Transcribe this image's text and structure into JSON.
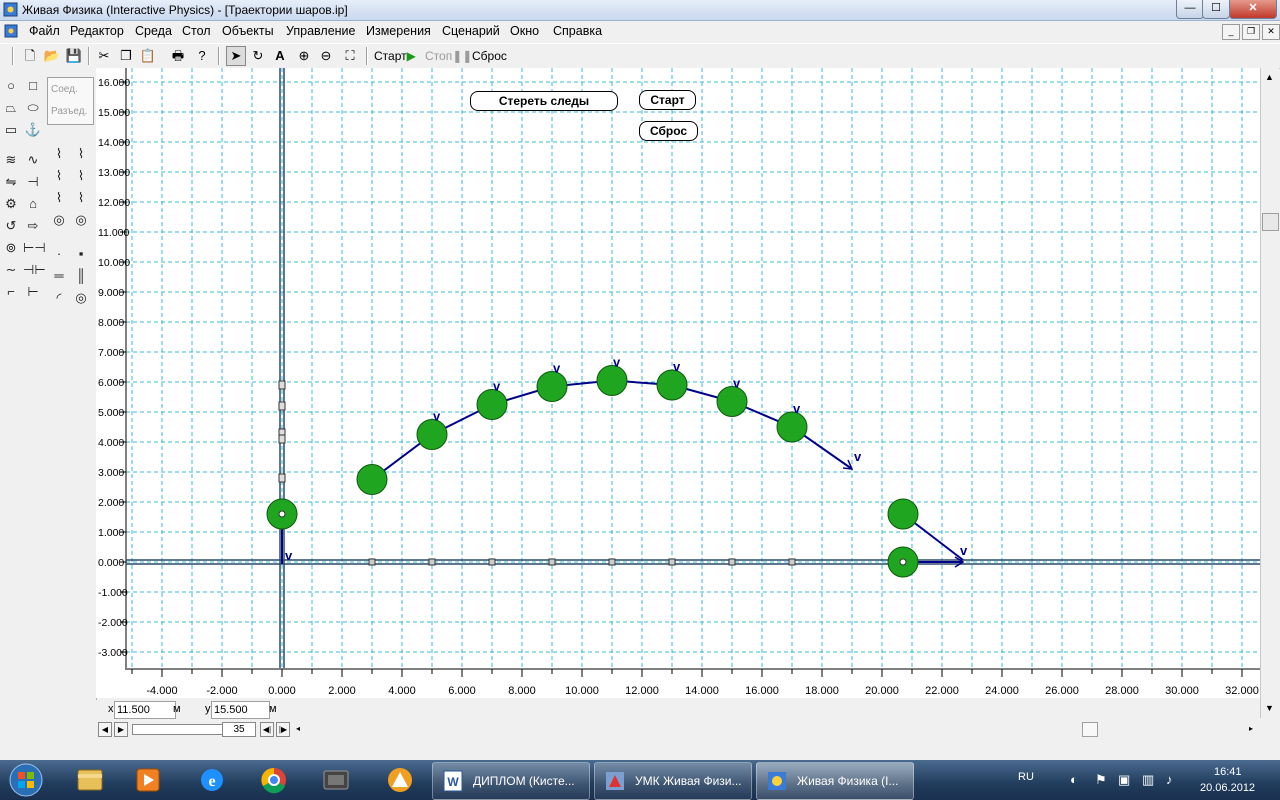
{
  "window": {
    "title": "Живая Физика (Interactive Physics) - [Траектории шаров.ip]",
    "minimize": "—",
    "maximize": "☐",
    "close": "✕"
  },
  "menu": [
    "Файл",
    "Редактор",
    "Среда",
    "Стол",
    "Объекты",
    "Управление",
    "Измерения",
    "Сценарий",
    "Окно",
    "Справка"
  ],
  "toolbar": {
    "start": "Старт",
    "stop": "Стоп",
    "reset": "Сброс"
  },
  "palette": {
    "join": "Соед.",
    "split": "Разъед."
  },
  "canvas": {
    "erase_button": "Стереть следы",
    "start_button": "Старт",
    "reset_button": "Сброс",
    "velocity_label": "v",
    "x_ticks": [
      "-4.000",
      "-2.000",
      "0.000",
      "2.000",
      "4.000",
      "6.000",
      "8.000",
      "10.000",
      "12.000",
      "14.000",
      "16.000",
      "18.000",
      "20.000",
      "22.000",
      "24.000",
      "26.000",
      "28.000",
      "30.000",
      "32.000"
    ],
    "y_ticks": [
      "16.000",
      "15.000",
      "14.000",
      "13.000",
      "12.000",
      "11.000",
      "10.000",
      "9.000",
      "8.000",
      "7.000",
      "6.000",
      "5.000",
      "4.000",
      "3.000",
      "2.000",
      "1.000",
      "0.000",
      "-1.000",
      "-2.000",
      "-3.000"
    ],
    "colors": {
      "grid": "#3bb8d8",
      "ball": "#1fa51f",
      "vector": "#00008b"
    },
    "trajectory_balls": [
      {
        "x": 3.0,
        "y": 2.75
      },
      {
        "x": 5.0,
        "y": 4.25
      },
      {
        "x": 7.0,
        "y": 5.25
      },
      {
        "x": 9.0,
        "y": 5.85
      },
      {
        "x": 11.0,
        "y": 6.05
      },
      {
        "x": 13.0,
        "y": 5.9
      },
      {
        "x": 15.0,
        "y": 5.35
      },
      {
        "x": 17.0,
        "y": 4.5
      }
    ],
    "free_balls": [
      {
        "x": 0.0,
        "y": 1.6
      },
      {
        "x": 20.7,
        "y": 1.6
      },
      {
        "x": 20.7,
        "y": 0.0
      }
    ]
  },
  "coords": {
    "x_label": "x",
    "x_value": "11.500",
    "x_unit": "м",
    "y_label": "y",
    "y_value": "15.500",
    "y_unit": "м"
  },
  "timeline": {
    "frame": "35"
  },
  "taskbar": {
    "tasks": [
      "ДИПЛОМ (Кисте...",
      "УМК Живая Физи...",
      "Живая Физика (I..."
    ],
    "lang": "RU",
    "time": "16:41",
    "date": "20.06.2012"
  }
}
